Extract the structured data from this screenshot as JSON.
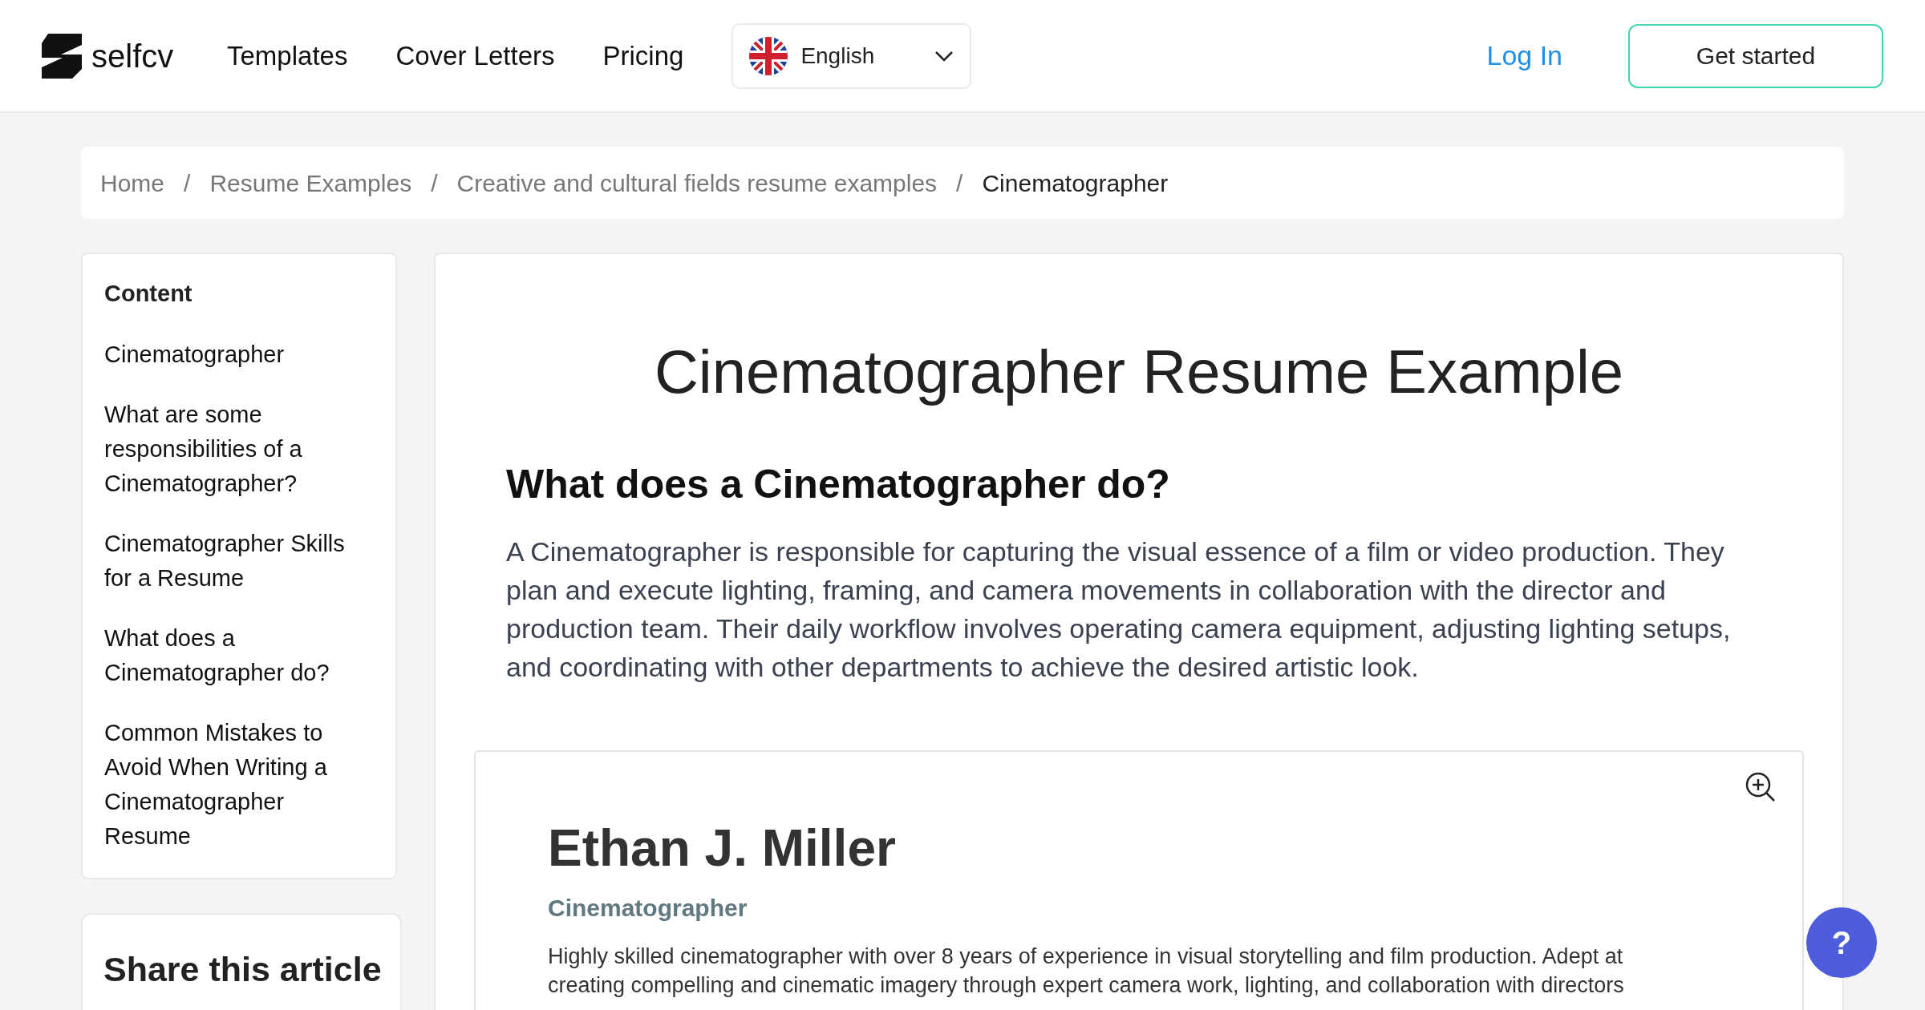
{
  "header": {
    "logo": "selfcv",
    "nav": [
      "Templates",
      "Cover Letters",
      "Pricing"
    ],
    "language": "English",
    "login": "Log In",
    "cta": "Get started"
  },
  "breadcrumb": [
    {
      "label": "Home",
      "current": false
    },
    {
      "separator": "/",
      "label": "Resume Examples",
      "current": false
    },
    {
      "separator": "/",
      "label": "Creative and cultural fields resume examples",
      "current": false
    },
    {
      "separator": "/",
      "label": "Cinematographer",
      "current": true
    }
  ],
  "sidebar": {
    "title": "Content",
    "items": [
      "Cinematographer",
      "What are some responsibilities of a Cinematographer?",
      "Cinematographer Skills for a Resume",
      "What does a Cinematographer do?",
      "Common Mistakes to Avoid When Writing a Cinematographer Resume"
    ]
  },
  "share": {
    "title": "Share this article"
  },
  "article": {
    "title": "Cinematographer Resume Example",
    "heading": "What does a Cinematographer do?",
    "paragraph": "A Cinematographer is responsible for capturing the visual essence of a film or video production. They plan and execute lighting, framing, and camera movements in collaboration with the director and production team. Their daily workflow involves operating camera equipment, adjusting lighting setups, and coordinating with other departments to achieve the desired artistic look.",
    "resume": {
      "name": "Ethan J. Miller",
      "role": "Cinematographer",
      "summary_lines": [
        "Highly skilled cinematographer with over 8 years of experience in visual storytelling and film production. Adept at",
        "creating compelling and cinematic imagery through expert camera work, lighting, and collaboration with directors"
      ]
    }
  },
  "help_button": "?"
}
